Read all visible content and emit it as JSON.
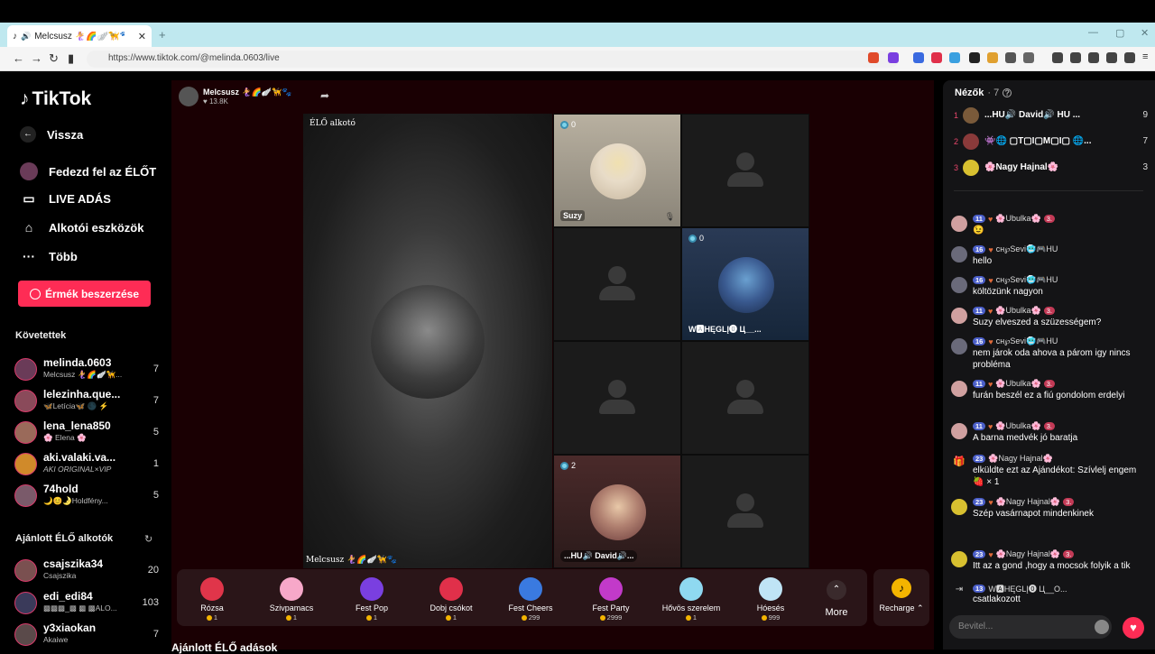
{
  "browser": {
    "tab_title": "Melcsusz 🧜‍♀️🌈🪽🦮🐾(",
    "url": "https://www.tiktok.com/@melinda.0603/live"
  },
  "sidebar": {
    "logo": "TikTok",
    "back": "Vissza",
    "explore_live": "Fedezd fel az ÉLŐT",
    "live_broadcast": "LIVE ADÁS",
    "creator_tools": "Alkotói eszközök",
    "more": "Több",
    "get_coins": "Érmék beszerzése",
    "following_header": "Követettek",
    "following": [
      {
        "name": "melinda.0603",
        "sub": "Melcsusz 🧜‍♀️🌈🪽🦮...",
        "count": "7"
      },
      {
        "name": "lelezinha.que...",
        "sub": "🦋Letícia🦋 🌑 ⚡",
        "count": "7"
      },
      {
        "name": "lena_lena850",
        "sub": "🌸 Elena 🌸",
        "count": "5"
      },
      {
        "name": "aki.valaki.va...",
        "sub": "AKI ORIGINAL×VIP",
        "count": "1"
      },
      {
        "name": "74hold",
        "sub": "🌙😊🌛Holdfény...",
        "count": "5"
      }
    ],
    "recommended_header": "Ajánlott ÉLŐ alkotók",
    "recommended": [
      {
        "name": "csajszika34",
        "sub": "Csajszika",
        "count": "20"
      },
      {
        "name": "edi_edi84",
        "sub": "▩▩▩_▩ ▩ ▩ALO...",
        "count": "103"
      },
      {
        "name": "y3xiaokan",
        "sub": "Akaiwe",
        "count": "7"
      }
    ]
  },
  "stream": {
    "host_name": "Melcsusz 🧜‍♀️🌈🪽🦮🐾",
    "likes": "13.8K",
    "creator_label": "ÉLŐ alkotó",
    "host_bottom_name": "Melcsusz 🧜‍♀️🌈🪽🦮🐾",
    "guests": [
      {
        "name": "Suzy",
        "count": "0"
      },
      {
        "name": "W🅰HĘGLĮ⓿ Ц__...",
        "count": "0"
      },
      {
        "name": "...HU🔊 David🔊...",
        "count": "2"
      }
    ]
  },
  "gifts": [
    {
      "label": "Rózsa",
      "price": "1",
      "color": "#e0354a"
    },
    {
      "label": "Szivpamacs",
      "price": "1",
      "color": "#f7a8c9"
    },
    {
      "label": "Fest Pop",
      "price": "1",
      "color": "#7a3fe0"
    },
    {
      "label": "Dobj csókot",
      "price": "1",
      "color": "#e0304a"
    },
    {
      "label": "Fest Cheers",
      "price": "299",
      "color": "#3a7ae0"
    },
    {
      "label": "Fest Party",
      "price": "2999",
      "color": "#c23ac9"
    },
    {
      "label": "Hővös szerelem",
      "price": "1",
      "color": "#8fd9f0"
    },
    {
      "label": "Hóesés",
      "price": "999",
      "color": "#bfe4f5"
    }
  ],
  "gift_more": "More",
  "recharge": "Recharge",
  "recommended_live": "Ajánlott ÉLŐ adások",
  "chat": {
    "viewers_label": "Nézők",
    "viewers_count": "· 7",
    "top_viewers": [
      {
        "rank": "1",
        "name": "...HU🔊 David🔊 HU ...",
        "score": "9"
      },
      {
        "rank": "2",
        "name": "👾🌐 ▢T▢I▢M▢I▢ 🌐...",
        "score": "7"
      },
      {
        "rank": "3",
        "name": "🌸Nagy Hajnal🌸",
        "score": "3"
      }
    ],
    "messages": [
      {
        "level": "11",
        "user": "🌸Ubulka🌸",
        "fan": "3.",
        "text": "😉"
      },
      {
        "level": "16",
        "user": "cн℘Sevi🥶🎮HU",
        "fan": "",
        "text": "hello"
      },
      {
        "level": "16",
        "user": "cн℘Sevi🥶🎮HU",
        "fan": "",
        "text": "költözünk nagyon"
      },
      {
        "level": "11",
        "user": "🌸Ubulka🌸",
        "fan": "3.",
        "text": "Suzy elveszed a szüzességem?"
      },
      {
        "level": "16",
        "user": "cн℘Sevi🥶🎮HU",
        "fan": "",
        "text": "nem járok oda ahova a párom igy nincs probléma"
      },
      {
        "level": "11",
        "user": "🌸Ubulka🌸",
        "fan": "3.",
        "text": "furán beszél ez a fiú gondolom erdelyi"
      },
      {
        "level": "11",
        "user": "🌸Ubulka🌸",
        "fan": "3.",
        "text": "A barna medvék jó baratja"
      },
      {
        "level": "23",
        "user": "🌸Nagy Hajnal🌸",
        "fan": "",
        "text": "elküldte ezt az Ajándékot: Szívlelj engem 🍓 × 1"
      },
      {
        "level": "23",
        "user": "🌸Nagy Hajnal🌸",
        "fan": "3.",
        "text": "Szép vasárnapot mindenkinek"
      },
      {
        "level": "23",
        "user": "🌸Nagy Hajnal🌸",
        "fan": "3.",
        "text": "Itt az a gond ,hogy a mocsok folyik a tik tokon"
      },
      {
        "level": "13",
        "user": "W🅰HĘGLĮ⓿ Ц__O...",
        "fan": "",
        "text": "csatlakozott"
      }
    ],
    "input_placeholder": "Bevitel..."
  }
}
